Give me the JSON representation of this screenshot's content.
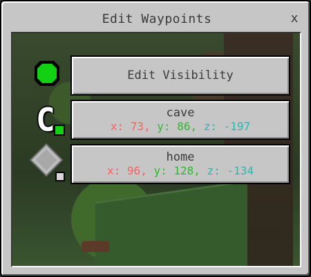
{
  "window": {
    "title": "Edit Waypoints",
    "close_glyph": "x"
  },
  "buttons": {
    "edit_visibility": "Edit Visibility"
  },
  "waypoints": [
    {
      "name": "cave",
      "x_label": "x:",
      "x": "73,",
      "y_label": "y:",
      "y": "86,",
      "z_label": "z:",
      "z": "-197",
      "icon": "letter-c-waypoint-icon",
      "color": "#12d012"
    },
    {
      "name": "home",
      "x_label": "x:",
      "x": "96,",
      "y_label": "y:",
      "y": "128,",
      "z_label": "z:",
      "z": "-134",
      "icon": "diamond-waypoint-icon",
      "color": "#d6d6d6"
    }
  ],
  "icons": {
    "visibility": "green-dot-visibility-icon"
  },
  "colors": {
    "x": "#ff5e5e",
    "y": "#2fb82f",
    "z": "#28b8b0",
    "panel": "#c6c6c6"
  }
}
